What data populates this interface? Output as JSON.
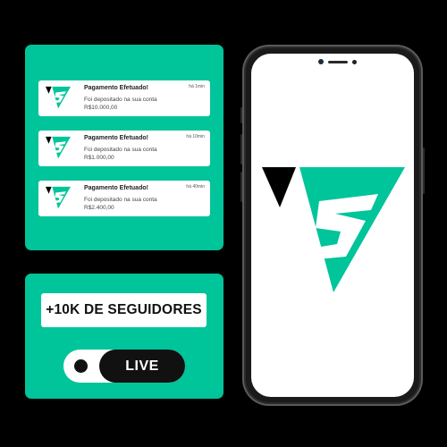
{
  "colors": {
    "background": "#000000",
    "accent": "#00C49A",
    "dark": "#111111",
    "white": "#ffffff"
  },
  "notifications": [
    {
      "title": "Pagamento Efetuado!",
      "time": "há 1min",
      "message": "Foi depositado na sua conta",
      "amount": "R$10.000,00",
      "icon": "brand-logo-icon"
    },
    {
      "title": "Pagamento Efetuado!",
      "time": "há 10min",
      "message": "Foi depositado na sua conta",
      "amount": "R$1.000,00",
      "icon": "brand-logo-icon"
    },
    {
      "title": "Pagamento Efetuado!",
      "time": "há 40min",
      "message": "Foi depositado na sua conta",
      "amount": "R$2.400,00",
      "icon": "brand-logo-icon"
    }
  ],
  "promo": {
    "followers_label": "+10K DE SEGUIDORES",
    "live_label": "LIVE"
  },
  "phone": {
    "screen_icon": "brand-logo-icon"
  }
}
